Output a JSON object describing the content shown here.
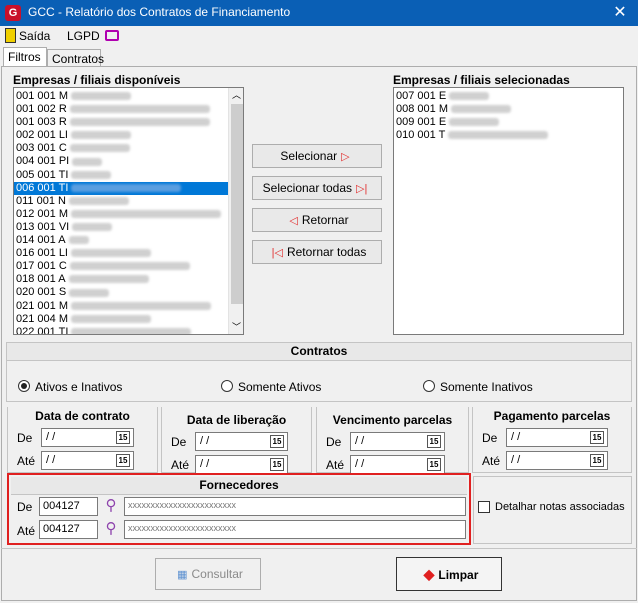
{
  "window": {
    "title": "GCC - Relatório dos Contratos de Financiamento",
    "close_glyph": "✕"
  },
  "menu": {
    "exit": "Saída",
    "lgpd": "LGPD"
  },
  "tabs": [
    "Filtros",
    "Contratos"
  ],
  "available": {
    "label": "Empresas / filiais disponíveis",
    "items": [
      "001 001 M",
      "001 002 R",
      "001 003 R",
      "002 001 LI",
      "003 001 C",
      "004 001 PI",
      "005 001 TI",
      "006 001 TI",
      "011 001 N",
      "012 001 M",
      "013 001 VI",
      "014 001 A",
      "016 001 LI",
      "017 001 C",
      "018 001 A",
      "020 001 S",
      "021 001 M",
      "021 004 M",
      "022 001 TI"
    ]
  },
  "selected": {
    "label": "Empresas / filiais selecionadas",
    "items": [
      "007 001 E",
      "008 001 M",
      "009 001 E",
      "010 001 T"
    ]
  },
  "buttons": {
    "select": "Selecionar",
    "select_all": "Selecionar todas",
    "return": "Retornar",
    "return_all": "Retornar todas",
    "consult": "Consultar",
    "clear": "Limpar"
  },
  "contracts": {
    "title": "Contratos",
    "options": [
      "Ativos e Inativos",
      "Somente Ativos",
      "Somente Inativos"
    ],
    "selected_option": "Ativos e Inativos"
  },
  "dates": {
    "from": "De",
    "to": "Até",
    "empty": "/ /",
    "cal_label": "15",
    "groups": [
      "Data de contrato",
      "Data de liberação",
      "Vencimento parcelas",
      "Pagamento parcelas"
    ]
  },
  "suppliers": {
    "title": "Fornecedores",
    "from_label": "De",
    "from_value": "004127",
    "from_name": "xxxxxxxxxxxxxxxxxxxxxxxx",
    "to_label": "Até",
    "to_value": "004127",
    "to_name": "xxxxxxxxxxxxxxxxxxxxxxxx",
    "detail_label": "Detalhar notas associadas"
  }
}
